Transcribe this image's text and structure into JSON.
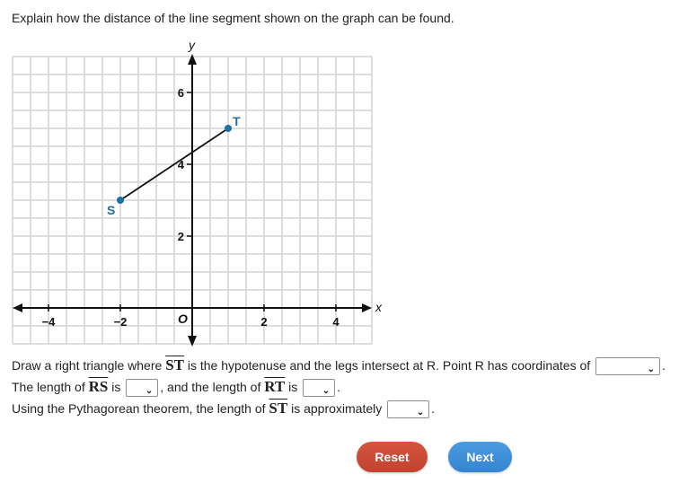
{
  "prompt": "Explain how the distance of the line segment shown on the graph can be found.",
  "chart_data": {
    "type": "scatter",
    "title": "",
    "xlabel": "x",
    "ylabel": "y",
    "xlim": [
      -5,
      5
    ],
    "ylim": [
      -1,
      7
    ],
    "grid": true,
    "grid_step": 0.5,
    "origin_label": "O",
    "x_ticks": [
      -4,
      -2,
      2,
      4
    ],
    "x_tick_labels": [
      "−4",
      "−2",
      "2",
      "4"
    ],
    "y_ticks": [
      2,
      4,
      6
    ],
    "y_tick_labels": [
      "2",
      "4",
      "6"
    ],
    "points": [
      {
        "label": "S",
        "x": -2,
        "y": 3
      },
      {
        "label": "T",
        "x": 1,
        "y": 5
      }
    ],
    "segments": [
      {
        "from": "S",
        "to": "T"
      }
    ],
    "colors": {
      "point": "#1f6fa3",
      "label": "#1f6fa3",
      "grid": "#d3d3d3",
      "axis": "#111111"
    }
  },
  "questions": {
    "line1": {
      "before": "Draw a right triangle where ",
      "seg": "ST",
      "after": " is the hypotenuse and the legs intersect at R. Point R has coordinates of",
      "dropdown_value": "",
      "end": "."
    },
    "line2": {
      "before": "The length of ",
      "seg1": "RS",
      "mid1": " is",
      "dropdown1_value": "",
      "mid2": ", and the length of ",
      "seg2": "RT",
      "mid3": " is",
      "dropdown2_value": "",
      "end": "."
    },
    "line3": {
      "before": "Using the Pythagorean theorem, the length of ",
      "seg": "ST",
      "after": " is approximately",
      "dropdown_value": "",
      "end": "."
    }
  },
  "buttons": {
    "reset": "Reset",
    "next": "Next",
    "reset_color": "#c84a35",
    "next_color": "#3d8fd8"
  }
}
